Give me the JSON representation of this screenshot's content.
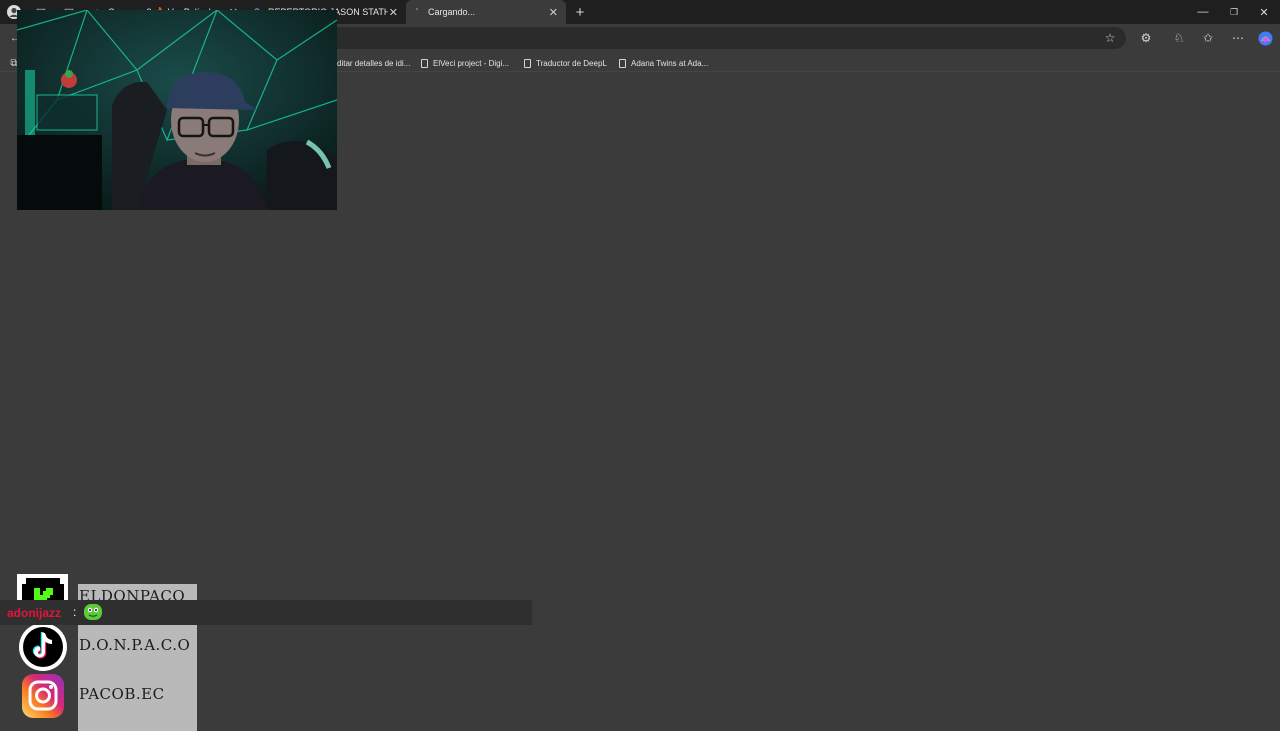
{
  "browser": {
    "tabs": [
      {
        "title": "Cuevana 3 🔥 Ver Películas o Series",
        "icon": "cuevana-icon"
      },
      {
        "title": "REPERTORIO JASON STATHAM - B",
        "icon": "search-icon"
      },
      {
        "title": "Cargando...",
        "icon": "loading-icon"
      }
    ],
    "new_tab_symbol": "+",
    "window_controls": {
      "minimize": "—",
      "restore": "❐",
      "close": "✕"
    },
    "favorites": [
      {
        "label": "ditar detalles de idi..."
      },
      {
        "label": "ElVeci project - Digi..."
      },
      {
        "label": "Traductor de DeepL"
      },
      {
        "label": "Adana Twins at Ada..."
      }
    ]
  },
  "overlay": {
    "socials": [
      {
        "platform": "kick-icon",
        "handle": "ELDONPACO"
      },
      {
        "platform": "tiktok-icon",
        "handle": "D.O.N.P.A.C.O"
      },
      {
        "platform": "instagram-icon",
        "handle": "PACOB.EC"
      }
    ],
    "chat": {
      "username": "adonijazz",
      "separator": ":",
      "emote": "frog-emote-icon"
    }
  },
  "colors": {
    "chat_username": "#e3143c",
    "kick_green": "#53fc18",
    "webcam_glow": "#19d9a9"
  }
}
